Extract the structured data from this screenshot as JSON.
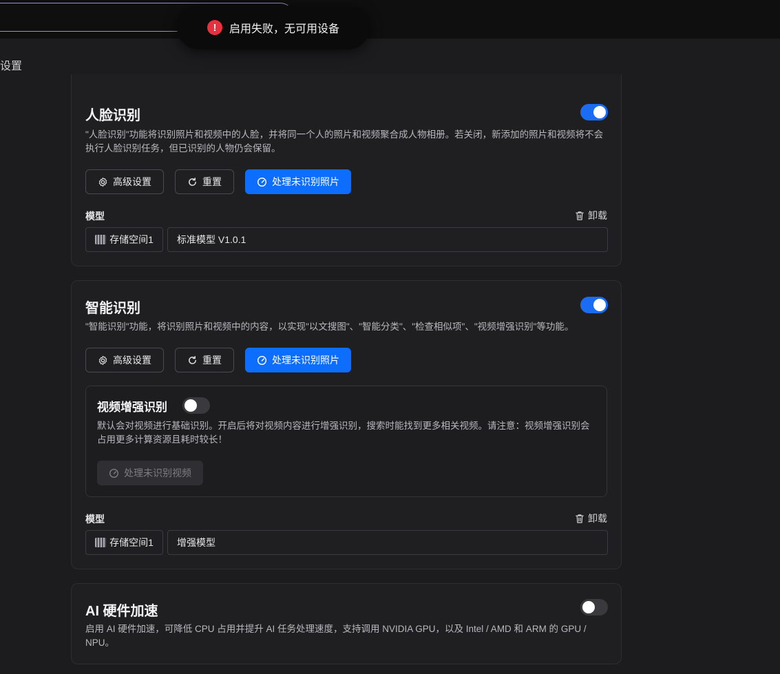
{
  "toast": {
    "message": "启用失败，无可用设备",
    "icon": "error-icon",
    "color": "#e8303f"
  },
  "page": {
    "title": "设置"
  },
  "face": {
    "title": "人脸识别",
    "enabled": true,
    "description": "\"人脸识别\"功能将识别照片和视频中的人脸，并将同一个人的照片和视频聚合成人物相册。若关闭，新添加的照片和视频将不会执行人脸识别任务，但已识别的人物仍会保留。",
    "buttons": {
      "advanced": "高级设置",
      "reset": "重置",
      "process": "处理未识别照片"
    },
    "model_label": "模型",
    "unload": "卸载",
    "storage": "存储空间1",
    "model": "标准模型 V1.0.1"
  },
  "smart": {
    "title": "智能识别",
    "enabled": true,
    "description": "\"智能识别\"功能，将识别照片和视频中的内容，以实现\"以文搜图\"、\"智能分类\"、\"检查相似项\"、\"视频增强识别\"等功能。",
    "buttons": {
      "advanced": "高级设置",
      "reset": "重置",
      "process": "处理未识别照片"
    },
    "video": {
      "title": "视频增强识别",
      "enabled": false,
      "description": "默认会对视频进行基础识别。开启后将对视频内容进行增强识别，搜索时能找到更多相关视频。请注意：视频增强识别会占用更多计算资源且耗时较长！",
      "button": "处理未识别视频"
    },
    "model_label": "模型",
    "unload": "卸载",
    "storage": "存储空间1",
    "model": "增强模型"
  },
  "hw": {
    "title": "AI 硬件加速",
    "enabled": false,
    "description": "启用 AI 硬件加速，可降低 CPU 占用并提升 AI 任务处理速度，支持调用 NVIDIA GPU，以及 Intel / AMD 和 ARM 的 GPU / NPU。"
  },
  "colors": {
    "accent": "#0d6efd",
    "background": "#1c1c1e",
    "card": "#1f1f21"
  }
}
